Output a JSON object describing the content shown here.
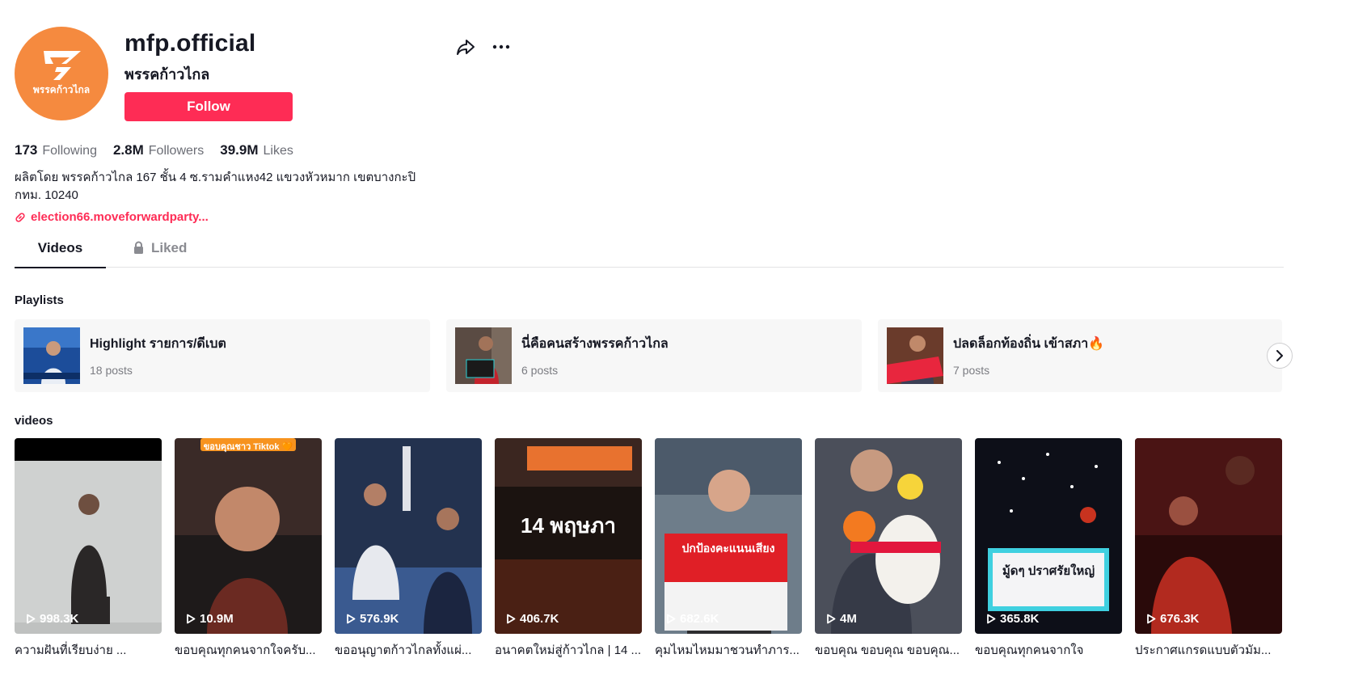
{
  "profile": {
    "username": "mfp.official",
    "nickname": "พรรคก้าวไกล",
    "avatar_text": "พรรคก้าวไกล",
    "follow_label": "Follow",
    "avatar_color": "#f58a3f",
    "accent_color": "#fe2c55"
  },
  "stats": {
    "following_count": "173",
    "following_label": "Following",
    "followers_count": "2.8M",
    "followers_label": "Followers",
    "likes_count": "39.9M",
    "likes_label": "Likes"
  },
  "bio": {
    "line1": "ผลิตโดย พรรคก้าวไกล 167 ชั้น 4 ซ.รามคำแหง42 แขวงหัวหมาก เขตบางกะปิ",
    "line2": "กทม. 10240",
    "link": "election66.moveforwardparty..."
  },
  "tabs": {
    "videos": "Videos",
    "liked": "Liked"
  },
  "playlists": {
    "title": "Playlists",
    "items": [
      {
        "name": "Highlight รายการ/ดีเบต",
        "count": "18 posts"
      },
      {
        "name": "นี่คือคนสร้างพรรคก้าวไกล",
        "count": "6 posts"
      },
      {
        "name": "ปลดล็อกท้องถิ่น เข้าสภา🔥",
        "count": "7 posts"
      }
    ]
  },
  "videos": {
    "title": "videos",
    "items": [
      {
        "views": "998.3K",
        "caption": "ความฝันที่เรียบง่าย ...",
        "overlay": ""
      },
      {
        "views": "10.9M",
        "caption": "ขอบคุณทุกคนจากใจครับ...",
        "overlay": "ขอบคุณชาว Tiktok 🧡"
      },
      {
        "views": "576.9K",
        "caption": "ขออนุญาตก้าวไกลทั้งแผ่...",
        "overlay": ""
      },
      {
        "views": "406.7K",
        "caption": "อนาคตใหม่สู่ก้าวไกล | 14 ...",
        "overlay": "14 พฤษภา"
      },
      {
        "views": "682.6K",
        "caption": "คุมไหมไหมมาชวนทำภาร...",
        "overlay": "ปกป้องคะแนนเสียง"
      },
      {
        "views": "4M",
        "caption": "ขอบคุณ ขอบคุณ ขอบคุณ...",
        "overlay": ""
      },
      {
        "views": "365.8K",
        "caption": "ขอบคุณทุกคนจากใจ",
        "overlay": "มู้ดๆ ปราศรัยใหญ่"
      },
      {
        "views": "676.3K",
        "caption": "ประกาศแกรดแบบตัวมัม...",
        "overlay": ""
      }
    ]
  }
}
